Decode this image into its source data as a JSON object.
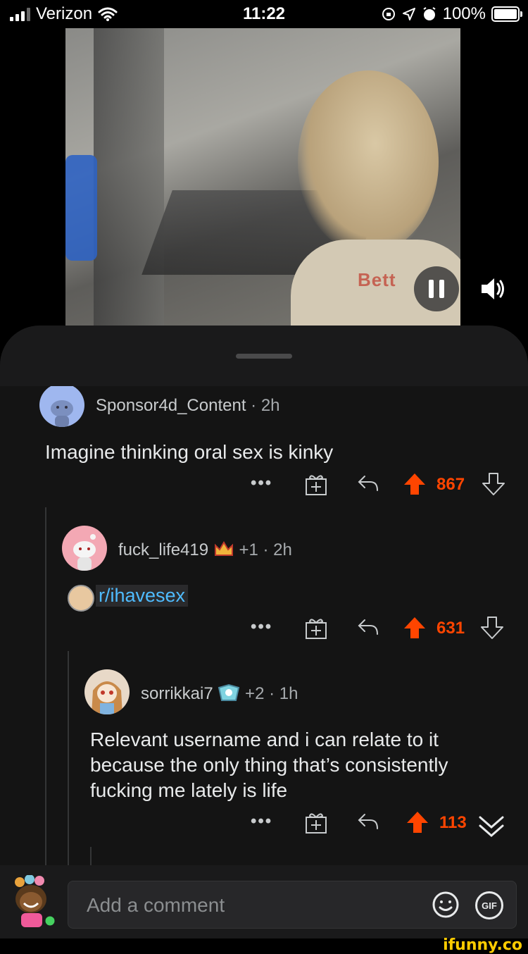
{
  "status_bar": {
    "carrier": "Verizon",
    "time": "11:22",
    "battery": "100%"
  },
  "comments": [
    {
      "username": "Sponsor4d_Content",
      "meta": "· 2h",
      "text": "Imagine thinking oral sex is kinky",
      "score": "867",
      "more_label": "•••",
      "avatar_color": "#9fb7ef"
    },
    {
      "username": "fuck_life419",
      "meta": "+1 · 2h",
      "link": "r/ihavesex",
      "score": "631",
      "more_label": "•••",
      "avatar_color": "#f3a8b4"
    },
    {
      "username": "sorrikkai7",
      "meta": "+2 · 1h",
      "text_lines": [
        "Relevant username and i can relate to it",
        "because the only thing that’s consistently",
        "fucking me lately is life"
      ],
      "score": "113",
      "more_label": "•••"
    }
  ],
  "composer": {
    "placeholder": "Add a comment",
    "gif_label": "GIF"
  },
  "watermark": "ifunny.co",
  "video_logo": "Bett",
  "colors": {
    "upvote": "#ff4500",
    "link": "#4fbcff",
    "background": "#141414"
  }
}
